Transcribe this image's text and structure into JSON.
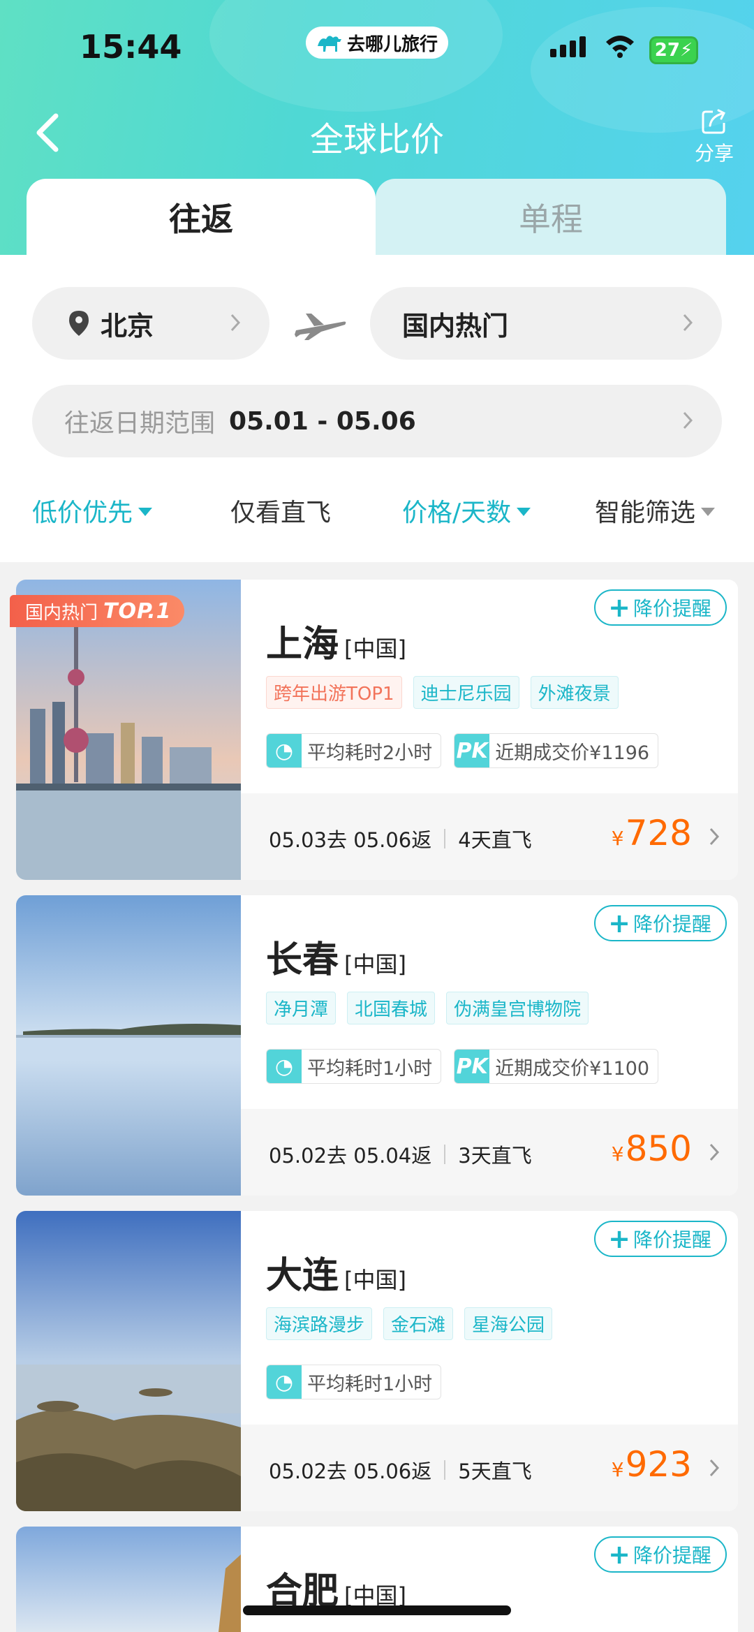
{
  "status_bar": {
    "time": "15:44",
    "app_badge": "去哪儿旅行",
    "battery": "27"
  },
  "nav": {
    "title": "全球比价",
    "share_label": "分享"
  },
  "tabs": [
    {
      "label": "往返",
      "active": true
    },
    {
      "label": "单程",
      "active": false
    }
  ],
  "search": {
    "from_city": "北京",
    "to_city": "国内热门",
    "date_label": "往返日期范围",
    "date_value": "05.01 - 05.06"
  },
  "filters": [
    {
      "label": "低价优先",
      "color": "#1bb6c8",
      "dropdown": true
    },
    {
      "label": "仅看直飞",
      "color": "#333333",
      "dropdown": false
    },
    {
      "label": "价格/天数",
      "color": "#1bb6c8",
      "dropdown": true
    },
    {
      "label": "智能筛选",
      "color": "#333333",
      "dropdown": true
    }
  ],
  "top_badge": {
    "prefix": "国内热门",
    "rank": "TOP.1"
  },
  "cards": [
    {
      "city": "上海",
      "country": "[中国]",
      "alert_label": "降价提醒",
      "tags": [
        {
          "text": "跨年出游TOP1",
          "hot": true
        },
        {
          "text": "迪士尼乐园",
          "hot": false
        },
        {
          "text": "外滩夜景",
          "hot": false
        }
      ],
      "avg_time": "平均耗时2小时",
      "pk_label": "PK",
      "recent_price": "近期成交价¥1196",
      "dates": "05.03去 05.06返",
      "days": "4天直飞",
      "currency": "¥",
      "price": "728"
    },
    {
      "city": "长春",
      "country": "[中国]",
      "alert_label": "降价提醒",
      "tags": [
        {
          "text": "净月潭",
          "hot": false
        },
        {
          "text": "北国春城",
          "hot": false
        },
        {
          "text": "伪满皇宫博物院",
          "hot": false
        }
      ],
      "avg_time": "平均耗时1小时",
      "pk_label": "PK",
      "recent_price": "近期成交价¥1100",
      "dates": "05.02去 05.04返",
      "days": "3天直飞",
      "currency": "¥",
      "price": "850"
    },
    {
      "city": "大连",
      "country": "[中国]",
      "alert_label": "降价提醒",
      "tags": [
        {
          "text": "海滨路漫步",
          "hot": false
        },
        {
          "text": "金石滩",
          "hot": false
        },
        {
          "text": "星海公园",
          "hot": false
        }
      ],
      "avg_time": "平均耗时1小时",
      "dates": "05.02去 05.06返",
      "days": "5天直飞",
      "currency": "¥",
      "price": "923"
    },
    {
      "city": "合肥",
      "country": "[中国]",
      "alert_label": "降价提醒"
    }
  ],
  "colors": {
    "accent": "#1bb6c8",
    "price": "#ff6a00",
    "hot_tag": "#f2735a"
  }
}
